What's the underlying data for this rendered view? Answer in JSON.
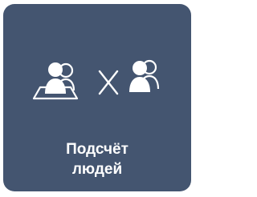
{
  "tile": {
    "label_line1": "Подсчёт",
    "label_line2": "людей",
    "background_color": "#445570",
    "foreground_color": "#ffffff"
  },
  "icons": [
    "people-on-area-icon",
    "cross-icon",
    "people-group-icon"
  ]
}
